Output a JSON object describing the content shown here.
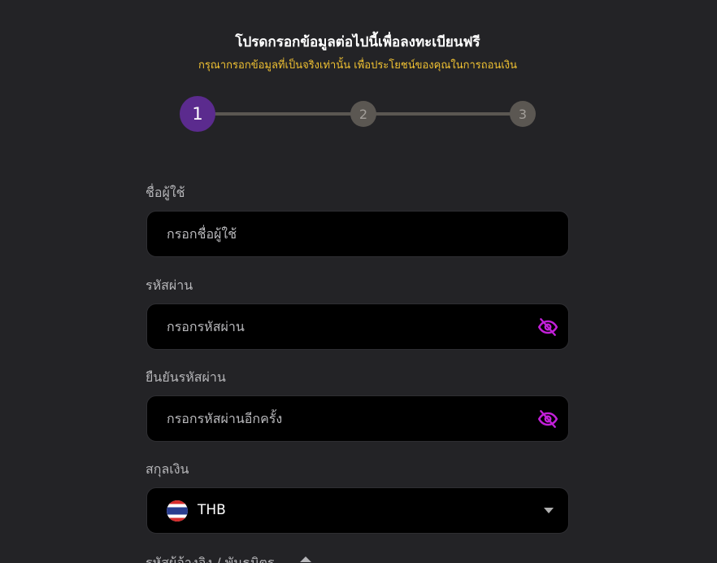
{
  "header": {
    "title": "โปรดกรอกข้อมูลต่อไปนี้เพื่อลงทะเบียนฟรี",
    "subtitle": "กรุณากรอกข้อมูลที่เป็นจริงเท่านั้น เพื่อประโยชน์ของคุณในการถอนเงิน"
  },
  "stepper": {
    "steps": [
      "1",
      "2",
      "3"
    ],
    "active_step": 1
  },
  "form": {
    "username": {
      "label": "ชื่อผู้ใช้",
      "placeholder": "กรอกชื่อผู้ใช้"
    },
    "password": {
      "label": "รหัสผ่าน",
      "placeholder": "กรอกรหัสผ่าน",
      "toggle_icon": "eye-off-icon"
    },
    "confirm_password": {
      "label": "ยืนยันรหัสผ่าน",
      "placeholder": "กรอกรหัสผ่านอีกครั้ง",
      "toggle_icon": "eye-off-icon"
    },
    "currency": {
      "label": "สกุลเงิน",
      "value": "THB",
      "flag_icon": "thailand-flag-icon"
    },
    "referral": {
      "label": "รหัสผู้อ้างอิง / พันธมิตร"
    }
  },
  "colors": {
    "background": "#232326",
    "field_background": "#000000",
    "accent_purple": "#5b2b8e",
    "subtitle_yellow": "#f1c232",
    "icon_magenta": "#c21fd8",
    "step_inactive": "#5b5752"
  }
}
